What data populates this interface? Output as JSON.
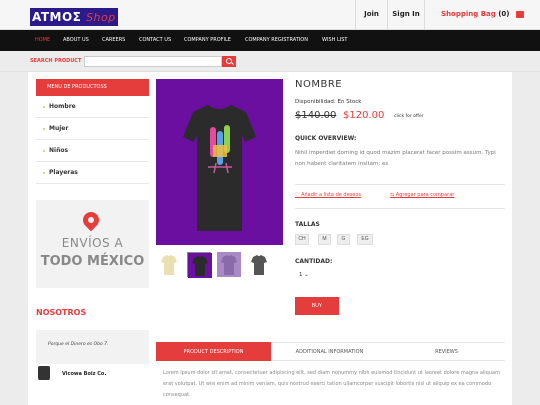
{
  "header": {
    "logo_main": "ATMOΣ",
    "logo_sub": "Shop",
    "join": "Join",
    "signin": "Sign In",
    "bag_label": "Shopping Bag",
    "bag_count": "(0)"
  },
  "nav": [
    "HOME",
    "ABOUT US",
    "CAREERS",
    "CONTACT US",
    "COMPANY PROFILE",
    "COMPANY REGISTRATION",
    "WISH LIST"
  ],
  "search": {
    "label": "SEARCH PRODUCT",
    "value": "",
    "placeholder": ""
  },
  "sidebar": {
    "menu_title": "MENU DE PRODUCTOSS",
    "items": [
      "Hombre",
      "Mujer",
      "Niños",
      "Playeras"
    ],
    "shipping_line1": "ENVÍOS A",
    "shipping_line2": "TODO MÉXICO",
    "nosotros_title": "NOSOTROS",
    "quote": "Porque el Dinero es Obo 7.",
    "author": "Vicowa Boiz Co."
  },
  "product": {
    "title": "NOMBRE",
    "availability": "Disponibilidad: En Stock",
    "old_price": "$140.00",
    "new_price": "$120.00",
    "offer_link": "click for offer",
    "quick_title": "QUICK OVERVIEW:",
    "quick_text": "Nihil imperdiet doming id quod mazim placerat facer possim assum. Typi non habent claritatem insitam; es",
    "wishlist_link": "Añadir a lista de deseos",
    "compare_link": "Agregar para comparar",
    "sizes_label": "TALLAS",
    "sizes": [
      "CH",
      "M",
      "G",
      "EG"
    ],
    "quantity_label": "CANTIDAD:",
    "quantity_value": "1",
    "buy_label": "BUY"
  },
  "tabs": [
    "PRODUCT DESCRIPTION",
    "ADDITIONAL INFORMATION",
    "REVIEWS"
  ],
  "description": "Lorem ipsum dolor sit amet, consectetuer adipiscing elit, sed diam nonummy nibh euismod tincidunt ut laoreet dolore magna aliquam erat volutpat. Ut wisi enim ad minim veniam, quis nostrud exerci tation ullamcorper suscipit lobortis nisl ut aliquip ex ea commodo consequat.",
  "colors": {
    "accent": "#e53c3c",
    "product_bg": "#6a0fa0",
    "nav_bg": "#111111"
  }
}
